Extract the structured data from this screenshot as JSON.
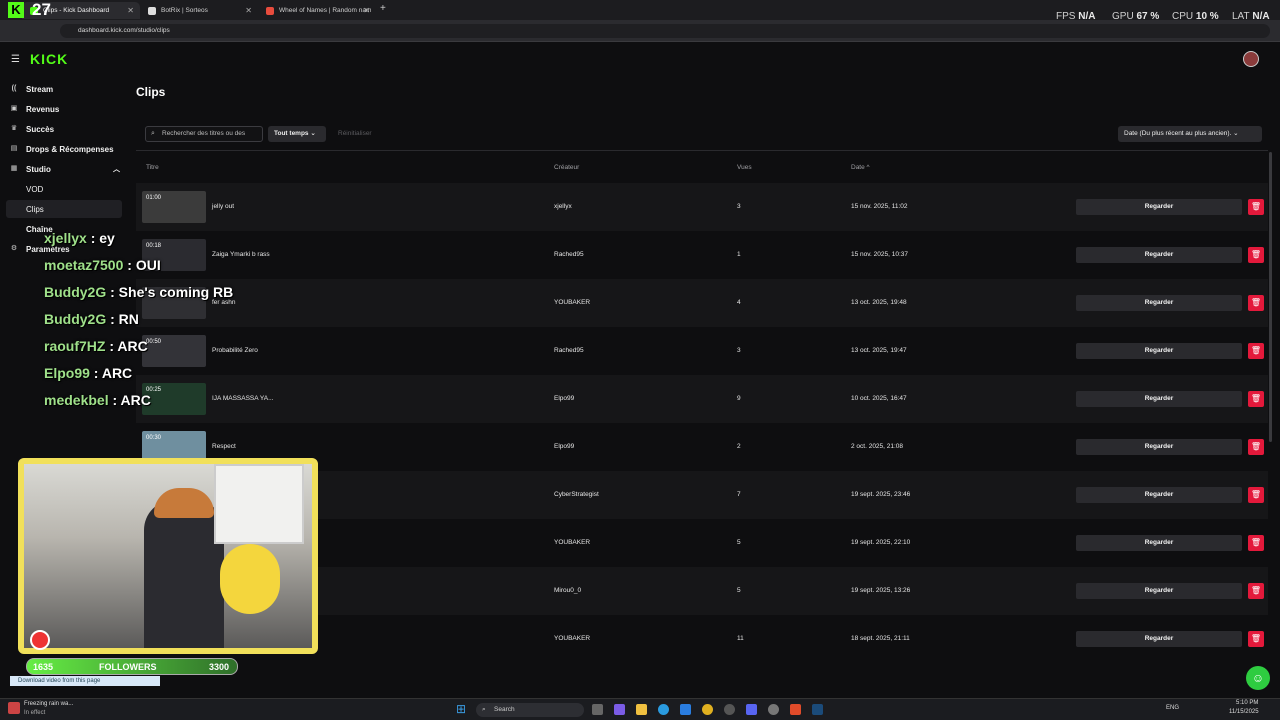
{
  "browser": {
    "tabs": [
      {
        "label": "Clips - Kick Dashboard",
        "active": true
      },
      {
        "label": "BotRix | Sorteos",
        "active": false
      },
      {
        "label": "Wheel of Names | Random nam",
        "active": false
      }
    ],
    "url": "dashboard.kick.com/studio/clips",
    "overlay_number": "27",
    "perf": [
      {
        "label": "FPS",
        "value": "N/A"
      },
      {
        "label": "GPU",
        "value": "67 %"
      },
      {
        "label": "CPU",
        "value": "10 %"
      },
      {
        "label": "LAT",
        "value": "N/A"
      }
    ]
  },
  "sidebar": {
    "logo": "KICK",
    "items": [
      {
        "label": "Stream",
        "icon": "broadcast-icon"
      },
      {
        "label": "Revenus",
        "icon": "money-icon"
      },
      {
        "label": "Succès",
        "icon": "trophy-icon"
      },
      {
        "label": "Drops & Récompenses",
        "icon": "gift-icon"
      },
      {
        "label": "Studio",
        "icon": "studio-icon"
      }
    ],
    "sub_items": [
      "VOD",
      "Clips"
    ],
    "more_items": [
      "Chaîne",
      "Paramètres"
    ]
  },
  "page": {
    "title": "Clips",
    "search_placeholder": "Rechercher des titres ou des",
    "filter_label": "Tout temps",
    "reset_label": "Réinitialiser",
    "sort_label": "Date (Du plus récent au plus ancien)."
  },
  "table": {
    "headers": {
      "title": "Titre",
      "creator": "Créateur",
      "views": "Vues",
      "date": "Date ^"
    },
    "watch_label": "Regarder",
    "rows": [
      {
        "duration": "01:00",
        "name": "jelly out",
        "creator": "xjellyx",
        "views": "3",
        "date": "15 nov. 2025, 11:02"
      },
      {
        "duration": "00:18",
        "name": "Zaiga Ymarki b rass",
        "creator": "Rached95",
        "views": "1",
        "date": "15 nov. 2025, 10:37"
      },
      {
        "duration": "",
        "name": "fer ashn",
        "creator": "YOUBAKER",
        "views": "4",
        "date": "13 oct. 2025, 19:48"
      },
      {
        "duration": "00:50",
        "name": "Probabilité Zero",
        "creator": "Rached95",
        "views": "3",
        "date": "13 oct. 2025, 19:47"
      },
      {
        "duration": "00:25",
        "name": "IJA MASSASSA YA...",
        "creator": "Elpo99",
        "views": "9",
        "date": "10 oct. 2025, 16:47"
      },
      {
        "duration": "00:30",
        "name": "Respect",
        "creator": "Elpo99",
        "views": "2",
        "date": "2 oct. 2025, 21:08"
      },
      {
        "duration": "",
        "name": "",
        "creator": "CyberStrategist",
        "views": "7",
        "date": "19 sept. 2025, 23:46"
      },
      {
        "duration": "",
        "name": "",
        "creator": "YOUBAKER",
        "views": "5",
        "date": "19 sept. 2025, 22:10"
      },
      {
        "duration": "",
        "name": "",
        "creator": "Mirou0_0",
        "views": "5",
        "date": "19 sept. 2025, 13:26"
      },
      {
        "duration": "",
        "name": "",
        "creator": "YOUBAKER",
        "views": "11",
        "date": "18 sept. 2025, 21:11"
      }
    ]
  },
  "chat": [
    {
      "user": "xjellyx",
      "msg": ": ey"
    },
    {
      "user": "moetaz7500",
      "msg": ": OUI"
    },
    {
      "user": "Buddy2G",
      "msg": ": She's coming RB"
    },
    {
      "user": "Buddy2G",
      "msg": ": RN"
    },
    {
      "user": "raouf7HZ",
      "msg": ": ARC"
    },
    {
      "user": "Elpo99",
      "msg": ": ARC"
    },
    {
      "user": "medekbel",
      "msg": ": ARC"
    }
  ],
  "stream_overlay": {
    "followers_current": "1635",
    "followers_label": "FOLLOWERS",
    "followers_goal": "3300",
    "download_text": "Download video from this page"
  },
  "taskbar": {
    "weather_title": "Freezing rain wa...",
    "weather_sub": "In effect",
    "search_placeholder": "Search",
    "lang": "ENG",
    "time": "5:10 PM",
    "date": "11/15/2025"
  },
  "colors": {
    "accent": "#53fc18",
    "delete": "#e3193b",
    "background": "#0e0e10"
  }
}
